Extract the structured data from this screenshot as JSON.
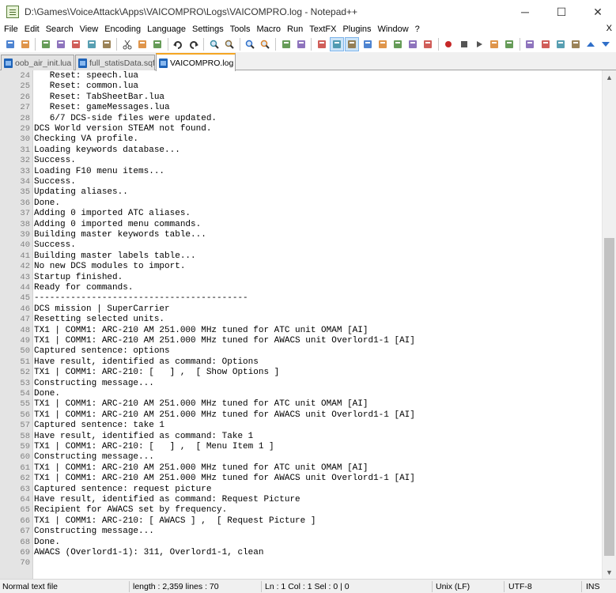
{
  "window": {
    "title": "D:\\Games\\VoiceAttack\\Apps\\VAICOMPRO\\Logs\\VAICOMPRO.log - Notepad++",
    "minimize": "─",
    "maximize": "☐",
    "close": "✕"
  },
  "menu": {
    "items": [
      "File",
      "Edit",
      "Search",
      "View",
      "Encoding",
      "Language",
      "Settings",
      "Tools",
      "Macro",
      "Run",
      "TextFX",
      "Plugins",
      "Window",
      "?"
    ],
    "close": "X"
  },
  "toolbar": {
    "buttons": [
      "new-file-icon",
      "open-file-icon",
      "save-icon",
      "save-all-icon",
      "close-icon",
      "close-all-icon",
      "print-icon",
      "cut-icon",
      "copy-icon",
      "paste-icon",
      "undo-icon",
      "redo-icon",
      "find-icon",
      "replace-icon",
      "zoom-in-icon",
      "zoom-out-icon",
      "sync-vertical-icon",
      "sync-horizontal-icon",
      "word-wrap-icon",
      "show-all-chars-icon",
      "indent-guide-icon",
      "user-language-icon",
      "document-map-icon",
      "function-list-icon",
      "folder-workspace-icon",
      "monitoring-icon",
      "record-macro-icon",
      "stop-macro-icon",
      "play-macro-icon",
      "run-macro-multiple-icon",
      "save-macro-icon",
      "plugin-a-icon",
      "plugin-b-icon",
      "plugin-c-icon",
      "plugin-d-icon",
      "arrow-up-icon",
      "arrow-down-icon"
    ]
  },
  "tabs": [
    {
      "label": "oob_air_init.lua",
      "active": false
    },
    {
      "label": "full_statisData.sqf",
      "active": false
    },
    {
      "label": "VAICOMPRO.log",
      "active": true
    }
  ],
  "editor": {
    "lines": [
      {
        "n": "24",
        "text": "   Reset: speech.lua"
      },
      {
        "n": "25",
        "text": "   Reset: common.lua"
      },
      {
        "n": "26",
        "text": "   Reset: TabSheetBar.lua"
      },
      {
        "n": "27",
        "text": "   Reset: gameMessages.lua"
      },
      {
        "n": "28",
        "text": "   6/7 DCS-side files were updated."
      },
      {
        "n": "29",
        "text": "DCS World version STEAM not found."
      },
      {
        "n": "30",
        "text": "Checking VA profile."
      },
      {
        "n": "31",
        "text": "Loading keywords database..."
      },
      {
        "n": "32",
        "text": "Success."
      },
      {
        "n": "33",
        "text": "Loading F10 menu items..."
      },
      {
        "n": "34",
        "text": "Success."
      },
      {
        "n": "35",
        "text": "Updating aliases.."
      },
      {
        "n": "36",
        "text": "Done."
      },
      {
        "n": "37",
        "text": "Adding 0 imported ATC aliases."
      },
      {
        "n": "38",
        "text": "Adding 0 imported menu commands."
      },
      {
        "n": "39",
        "text": "Building master keywords table..."
      },
      {
        "n": "40",
        "text": "Success."
      },
      {
        "n": "41",
        "text": "Building master labels table..."
      },
      {
        "n": "42",
        "text": "No new DCS modules to import."
      },
      {
        "n": "43",
        "text": "Startup finished."
      },
      {
        "n": "44",
        "text": "Ready for commands."
      },
      {
        "n": "45",
        "text": "-----------------------------------------"
      },
      {
        "n": "46",
        "text": "DCS mission | SuperCarrier"
      },
      {
        "n": "47",
        "text": "Resetting selected units."
      },
      {
        "n": "48",
        "text": "TX1 | COMM1: ARC-210 AM 251.000 MHz tuned for ATC unit OMAM [AI]"
      },
      {
        "n": "49",
        "text": "TX1 | COMM1: ARC-210 AM 251.000 MHz tuned for AWACS unit Overlord1-1 [AI]"
      },
      {
        "n": "50",
        "text": "Captured sentence: options"
      },
      {
        "n": "51",
        "text": "Have result, identified as command: Options"
      },
      {
        "n": "52",
        "text": "TX1 | COMM1: ARC-210: [   ] ,  [ Show Options ]"
      },
      {
        "n": "53",
        "text": "Constructing message..."
      },
      {
        "n": "54",
        "text": "Done."
      },
      {
        "n": "55",
        "text": "TX1 | COMM1: ARC-210 AM 251.000 MHz tuned for ATC unit OMAM [AI]"
      },
      {
        "n": "56",
        "text": "TX1 | COMM1: ARC-210 AM 251.000 MHz tuned for AWACS unit Overlord1-1 [AI]"
      },
      {
        "n": "57",
        "text": "Captured sentence: take 1"
      },
      {
        "n": "58",
        "text": "Have result, identified as command: Take 1"
      },
      {
        "n": "59",
        "text": "TX1 | COMM1: ARC-210: [   ] ,  [ Menu Item 1 ]"
      },
      {
        "n": "60",
        "text": "Constructing message..."
      },
      {
        "n": "61",
        "text": "TX1 | COMM1: ARC-210 AM 251.000 MHz tuned for ATC unit OMAM [AI]"
      },
      {
        "n": "62",
        "text": "TX1 | COMM1: ARC-210 AM 251.000 MHz tuned for AWACS unit Overlord1-1 [AI]"
      },
      {
        "n": "63",
        "text": "Captured sentence: request picture"
      },
      {
        "n": "64",
        "text": "Have result, identified as command: Request Picture"
      },
      {
        "n": "65",
        "text": "Recipient for AWACS set by frequency."
      },
      {
        "n": "66",
        "text": "TX1 | COMM1: ARC-210: [ AWACS ] ,  [ Request Picture ]"
      },
      {
        "n": "67",
        "text": "Constructing message..."
      },
      {
        "n": "68",
        "text": "Done."
      },
      {
        "n": "69",
        "text": "AWACS (Overlord1-1): 311, Overlord1-1, clean"
      },
      {
        "n": "70",
        "text": ""
      }
    ],
    "scroll": {
      "up": "▲",
      "down": "▼",
      "thumb_start": 0.32,
      "thumb_size": 0.66
    }
  },
  "status": {
    "file_type": "Normal text file",
    "length": "length : 2,359    lines : 70",
    "position": "Ln : 1    Col : 1    Sel : 0 | 0",
    "eol": "Unix (LF)",
    "encoding": "UTF-8",
    "mode": "INS"
  },
  "colors": {
    "active_tab_accent": "#f5a623",
    "tab_close_active": "#e5442a",
    "gutter_bg": "#e4e4e4",
    "line_number": "#808080"
  }
}
